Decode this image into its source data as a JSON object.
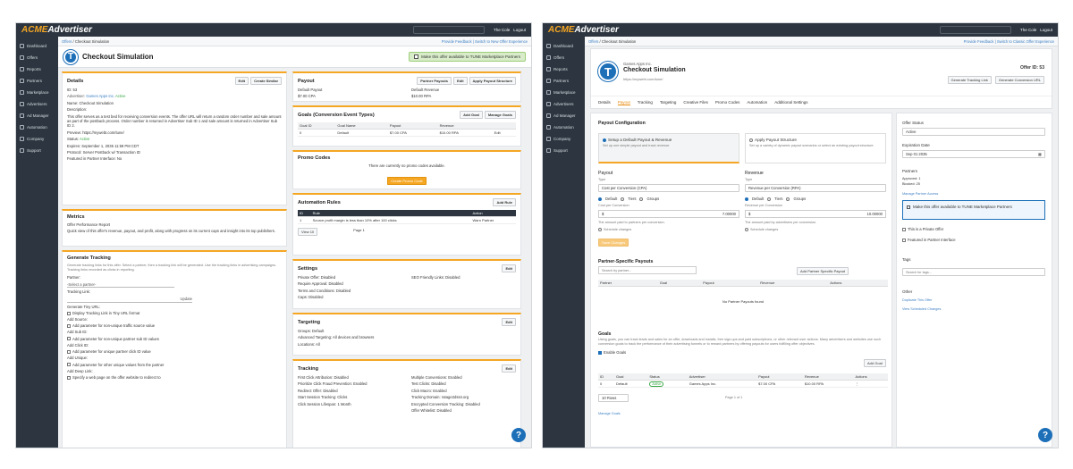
{
  "app": {
    "logo_acme": "ACME",
    "logo_rest": "Advertiser",
    "user": "The Cole",
    "logout": "Logout"
  },
  "nav": [
    "Dashboard",
    "Offers",
    "Reports",
    "Partners",
    "Marketplace",
    "Advertisers",
    "Ad Manager",
    "Automation",
    "Company",
    "Support"
  ],
  "shotA": {
    "crumb": [
      "Offers",
      "Checkout Simulation"
    ],
    "crumb_right": "Provide Feedback | Switch to New Offer Experience",
    "title": "Checkout Simulation",
    "marketplace_banner": "Make this offer available to TUNE Marketplace Partners",
    "details": {
      "title": "Details",
      "edit": "Edit",
      "create_similar": "Create Similar",
      "id": "ID: 53",
      "advertiser_label": "Advertiser:",
      "advertiser_value": "Games Apps Inc.",
      "advertiser_status": "Active",
      "name": "Name: Checkout Simulation",
      "description_label": "Description:",
      "description": "This offer serves as a test bed for receiving conversion events. The offer URL will return a random order number and sale amount as part of the postback process. Order number is returned in Advertiser Sub ID 1 and sale amount is returned in Advertiser Sub ID 2.",
      "preview": "Preview: https://mywebt.com/tune/",
      "status_label": "Status:",
      "status": "Active",
      "expires": "Expires: September 1, 2035 11:59 PM CDT",
      "protocol": "Protocol: Server Postback w/ Transaction ID",
      "featured": "Featured in Partner Interface: No"
    },
    "metrics": {
      "title": "Metrics",
      "link": "Offer Performance Report",
      "desc": "Quick view of this offer's revenue, payout, and profit, along with progress on its current caps and insight into its top publishers."
    },
    "tracking_gen": {
      "title": "Generate Tracking",
      "desc": "Generate tracking links for this offer. Select a partner, then a tracking link will be generated. Use the tracking links in advertising campaigns. Tracking links recorded as clicks in reporting.",
      "partner_label": "Partner:",
      "partner_placeholder": "-Select a partner-",
      "link_label": "Tracking Link:",
      "update": "Update",
      "tiny_label": "Generate Tiny URL:",
      "tiny_opt": "Display Tracking Link in Tiny URL format",
      "source_label": "Add Source:",
      "source_opt": "Add parameter for non-unique traffic source value",
      "sub_label": "Add Sub ID:",
      "sub_opt": "Add parameter for non-unique partner sub ID values",
      "click_label": "Add Click ID:",
      "click_opt": "Add parameter for unique partner click ID value",
      "unique_label": "Add Unique:",
      "unique_opt": "Add parameter for other unique values from the partner",
      "deep_label": "Add Deep Link:",
      "deep_opt": "Specify a web page on the offer website to redirect to"
    },
    "payout": {
      "title": "Payout",
      "partner_payouts": "Partner Payouts",
      "edit": "Edit",
      "apply": "Apply Payout Structure",
      "dp_label": "Default Payout",
      "dp_value": "$7.00 CPA",
      "dr_label": "Default Revenue",
      "dr_value": "$10.00 RPA"
    },
    "goals": {
      "title": "Goals (Conversion Event Types)",
      "add": "Add Goal",
      "manage": "Manage Goals",
      "headers": [
        "Goal ID",
        "Goal Name",
        "Payout",
        "Revenue",
        ""
      ],
      "row": [
        "0",
        "Default",
        "$7.00 CPA",
        "$10.00 RPA",
        "Edit"
      ]
    },
    "promo": {
      "title": "Promo Codes",
      "empty": "There are currently no promo codes available.",
      "create": "Create Promo Code"
    },
    "automation": {
      "title": "Automation Rules",
      "add": "Add Rule",
      "headers": [
        "ID",
        "Rule",
        "Action"
      ],
      "row": [
        "1",
        "Source profit margin is less than 10% after 100 clicks",
        "Warn Partner"
      ],
      "view": "View 10",
      "page": "Page 1"
    },
    "settings": {
      "title": "Settings",
      "edit": "Edit",
      "rows": [
        "Private Offer: Disabled",
        "Require Approval: Disabled",
        "Terms and Conditions: Disabled",
        "Caps: Disabled"
      ],
      "seo": "SEO Friendly Links: Disabled"
    },
    "targeting": {
      "title": "Targeting",
      "edit": "Edit",
      "rows": [
        "Groups: Default",
        "Advanced Targeting: All devices and browsers",
        "Locations: All"
      ]
    },
    "tracking": {
      "title": "Tracking",
      "edit": "Edit",
      "left": [
        "First Click Attribution: Disabled",
        "Prioritize Click Fraud Prevention: Enabled",
        "Redirect Offer: Disabled",
        "Start Session Tracking: Clicks",
        "Click Session Lifespan: 1 Month"
      ],
      "right": [
        "Multiple Conversions: Enabled",
        "Test Clicks: Disabled",
        "Click Macro: Enabled",
        "Tracking Domain: ratage2dss4.org",
        "Encrypted Conversion Tracking: Disabled",
        "Offer Whitelist: Disabled"
      ]
    }
  },
  "shotB": {
    "crumb": [
      "Offers",
      "Checkout Simulation"
    ],
    "crumb_right": "Provide Feedback | Switch to Classic Offer Experience",
    "advertiser": "Games Apps Inc.",
    "title": "Checkout Simulation",
    "url": "https://mywebt.com/tune/",
    "offer_id": "Offer ID: 53",
    "gen_link": "Generate Tracking Link",
    "gen_conv": "Generate Conversion URL",
    "tabs": [
      "Details",
      "Payout",
      "Tracking",
      "Targeting",
      "Creative Files",
      "Promo Codes",
      "Automation",
      "Additional Settings"
    ],
    "payout_config": "Payout Configuration",
    "opt1_title": "Setup a Default Payout & Revenue",
    "opt1_desc": "Set up one simple payout and track revenue.",
    "opt2_title": "Apply Payout Structure",
    "opt2_desc": "Set up a variety of dynamic payout scenarios or select an existing payout structure.",
    "payout": "Payout",
    "revenue": "Revenue",
    "type": "Type",
    "payout_type": "Cost per Conversion (CPA)",
    "revenue_type": "Revenue per Conversion (RPA)",
    "radios": [
      "Default",
      "Tiers",
      "Groups"
    ],
    "cost_label": "Cost per Conversion",
    "cost_currency": "$",
    "cost_value": "7.00000",
    "rev_label": "Revenue per Conversion",
    "rev_currency": "$",
    "rev_value": "10.00000",
    "cost_help": "The amount paid to partners per conversion.",
    "rev_help": "The amount paid by advertisers per conversion.",
    "schedule": "Schedule changes",
    "save": "Save Changes",
    "psp_title": "Partner-Specific Payouts",
    "psp_search": "Search by partner...",
    "psp_add": "Add Partner Specific Payout",
    "psp_headers": [
      "Partner",
      "Goal",
      "Payout",
      "Revenue",
      "Actions"
    ],
    "psp_empty": "No Partner Payouts found",
    "goals_title": "Goals",
    "goals_desc": "Using goals, you can track leads and sales for an offer, downloads and installs, free sign-ups and paid subscriptions, or other relevant user actions. Many advertisers and websites use such conversion goals to track the performance of their advertising funnels or to reward partners by offering payouts for users fulfilling offer objectives.",
    "enable_goals": "Enable Goals",
    "add_goal": "Add Goal",
    "goal_headers": [
      "ID",
      "Goal",
      "Status",
      "Advertiser",
      "Payout",
      "Revenue",
      "Actions"
    ],
    "goal_row": [
      "0",
      "Default",
      "Active",
      "Games Apps Inc.",
      "$7.00 CPA",
      "$10.00 RPA"
    ],
    "rows_sel": "10 Rows",
    "page": "Page 1 of 1",
    "manage_goals": "Manage Goals",
    "side": {
      "status_label": "Offer Status",
      "status": "Active",
      "exp_label": "Expiration Date",
      "exp": "Sep 01 2035",
      "partners_label": "Partners",
      "approved": "Approved: 1",
      "blocked": "Blocked: 25",
      "manage": "Manage Partner Access",
      "mp": "Make this offer available to TUNE Marketplace Partners",
      "private": "This is a Private Offer",
      "featured": "Featured in Partner Interface",
      "tags_label": "Tags",
      "tags_placeholder": "Search for tags...",
      "other_label": "Other",
      "duplicate": "Duplicate This Offer",
      "scheduled": "View Scheduled Changes"
    }
  },
  "colors": {
    "accent": "#f5a623",
    "brand": "#1d6fb8",
    "sidebar": "#2d3640",
    "active": "#39a845"
  }
}
